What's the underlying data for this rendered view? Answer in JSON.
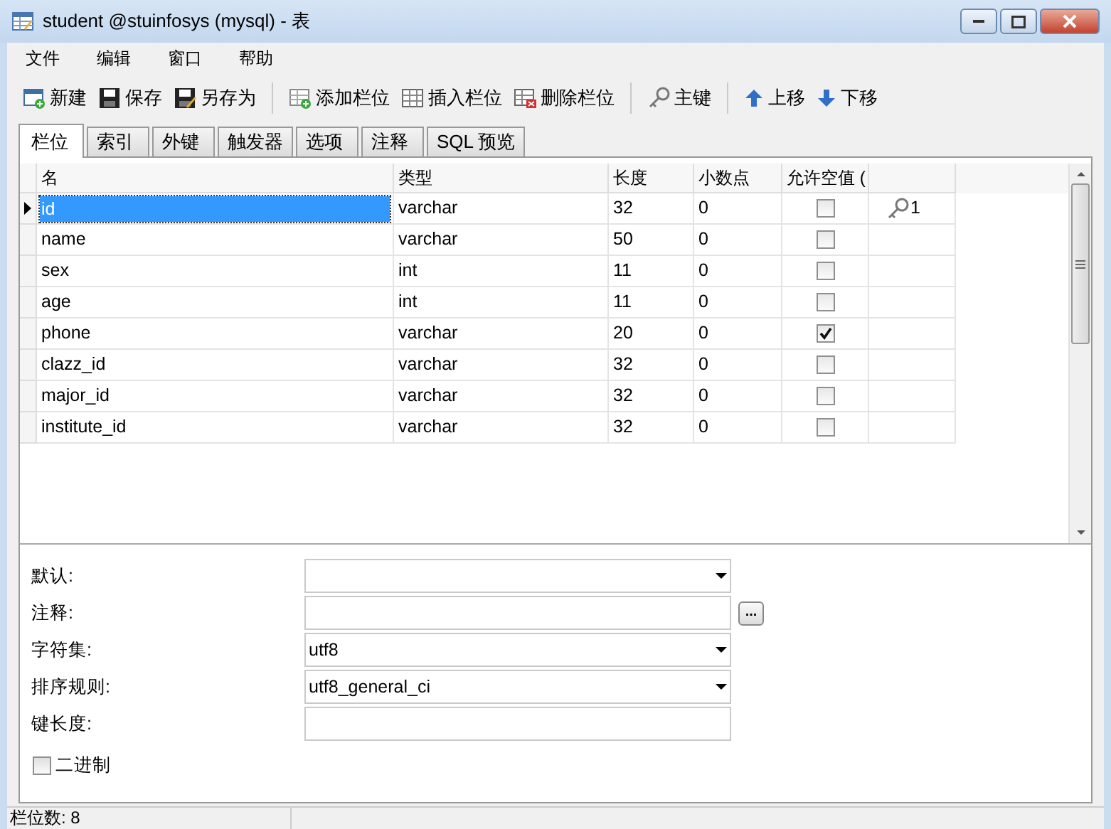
{
  "window": {
    "title": "student @stuinfosys (mysql) - 表"
  },
  "menu": [
    "文件",
    "编辑",
    "窗口",
    "帮助"
  ],
  "toolbar": [
    {
      "kind": "new",
      "label": "新建"
    },
    {
      "kind": "save",
      "label": "保存"
    },
    {
      "kind": "saveas",
      "label": "另存为"
    },
    {
      "kind": "add",
      "label": "添加栏位"
    },
    {
      "kind": "insert",
      "label": "插入栏位"
    },
    {
      "kind": "delete",
      "label": "删除栏位"
    },
    {
      "kind": "key",
      "label": "主键"
    },
    {
      "kind": "up",
      "label": "上移"
    },
    {
      "kind": "down",
      "label": "下移"
    }
  ],
  "tabs": [
    {
      "label": "栏位",
      "selected": true
    },
    {
      "label": "索引",
      "selected": false
    },
    {
      "label": "外键",
      "selected": false
    },
    {
      "label": "触发器",
      "selected": false
    },
    {
      "label": "选项",
      "selected": false
    },
    {
      "label": "注释",
      "selected": false
    },
    {
      "label": "SQL 预览",
      "selected": false
    }
  ],
  "table": {
    "columns": [
      "名",
      "类型",
      "长度",
      "小数点",
      "允许空值 ("
    ],
    "rows": [
      {
        "name": "id",
        "type": "varchar",
        "length": "32",
        "decimals": "0",
        "nullable": false,
        "key": "1",
        "selected": true
      },
      {
        "name": "name",
        "type": "varchar",
        "length": "50",
        "decimals": "0",
        "nullable": false,
        "selected": false
      },
      {
        "name": "sex",
        "type": "int",
        "length": "11",
        "decimals": "0",
        "nullable": false,
        "selected": false
      },
      {
        "name": "age",
        "type": "int",
        "length": "11",
        "decimals": "0",
        "nullable": false,
        "selected": false
      },
      {
        "name": "phone",
        "type": "varchar",
        "length": "20",
        "decimals": "0",
        "nullable": true,
        "selected": false
      },
      {
        "name": "clazz_id",
        "type": "varchar",
        "length": "32",
        "decimals": "0",
        "nullable": false,
        "selected": false
      },
      {
        "name": "major_id",
        "type": "varchar",
        "length": "32",
        "decimals": "0",
        "nullable": false,
        "selected": false
      },
      {
        "name": "institute_id",
        "type": "varchar",
        "length": "32",
        "decimals": "0",
        "nullable": false,
        "selected": false
      }
    ]
  },
  "properties": [
    {
      "kind": "dropdown",
      "label": "默认:"
    },
    {
      "kind": "text_button",
      "label": "注释:",
      "button": "..."
    },
    {
      "kind": "dropdown",
      "label": "字符集:",
      "value": "utf8"
    },
    {
      "kind": "dropdown",
      "label": "排序规则:",
      "value": "utf8_general_ci"
    },
    {
      "kind": "text",
      "label": "键长度:"
    }
  ],
  "binary": {
    "label": "二进制",
    "checked": false
  },
  "status_bar": "栏位数: 8"
}
